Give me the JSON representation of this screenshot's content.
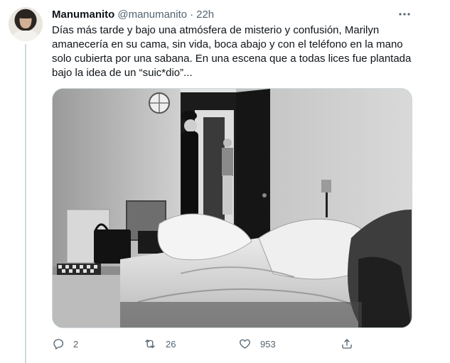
{
  "author": {
    "display_name": "Manumanito",
    "handle": "@manumanito",
    "separator": "·",
    "time": "22h"
  },
  "tweet": {
    "text": "Días más tarde y bajo una atmósfera de misterio y confusión, Marilyn amanecería en su cama, sin vida, boca abajo y con el teléfono en la mano solo cubierta por una sabana. En una escena que a todas lices fue plantada bajo la idea de un “suic*dio”..."
  },
  "actions": {
    "reply": {
      "icon": "reply-icon",
      "count": "2"
    },
    "retweet": {
      "icon": "retweet-icon",
      "count": "26"
    },
    "like": {
      "icon": "heart-icon",
      "count": "953"
    },
    "share": {
      "icon": "share-icon"
    }
  },
  "colors": {
    "text_primary": "#0f1419",
    "text_secondary": "#536471",
    "border": "#cfd9de"
  }
}
